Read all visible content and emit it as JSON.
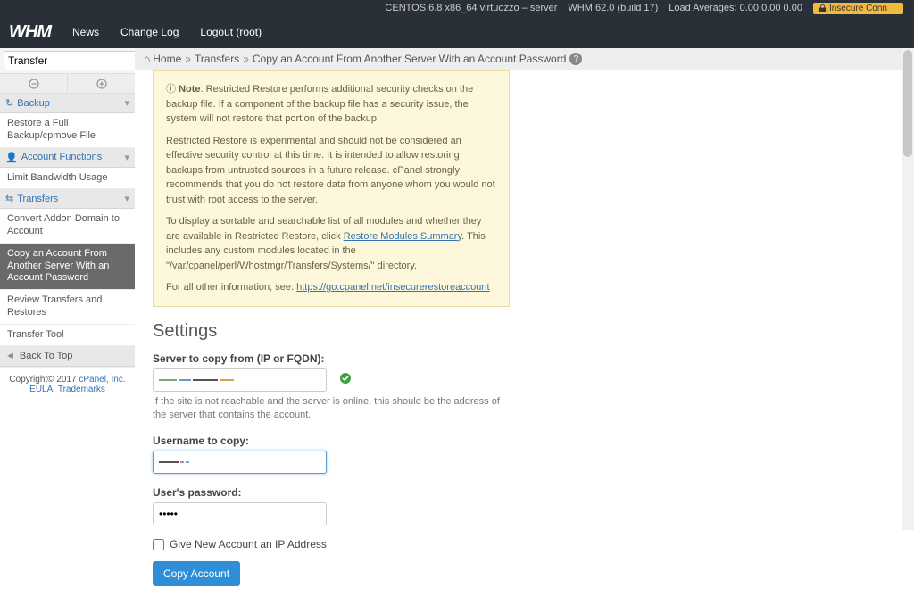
{
  "topbar": {
    "os": "CENTOS 6.8 x86_64 virtuozzo – server",
    "whm": "WHM 62.0 (build 17)",
    "load": "Load Averages: 0.00 0.00 0.00",
    "insecure": "Insecure Conn"
  },
  "nav": {
    "logo": "WHM",
    "news": "News",
    "changelog": "Change Log",
    "logout": "Logout (root)"
  },
  "search": {
    "value": "Transfer"
  },
  "sidebar": {
    "backup_cat": "Backup",
    "backup_item": "Restore a Full Backup/cpmove File",
    "acct_cat": "Account Functions",
    "acct_item": "Limit Bandwidth Usage",
    "trans_cat": "Transfers",
    "t1": "Convert Addon Domain to Account",
    "t2": "Copy an Account From Another Server With an Account Password",
    "t3": "Review Transfers and Restores",
    "t4": "Transfer Tool",
    "backtop": "Back To Top"
  },
  "copyright": {
    "line": "Copyright© 2017 ",
    "cp": "cPanel, Inc.",
    "eula": "EULA",
    "tm": "Trademarks"
  },
  "breadcrumb": {
    "home": "Home",
    "transfers": "Transfers",
    "page": "Copy an Account From Another Server With an Account Password"
  },
  "note": {
    "intro": "Note",
    "p1": ": Restricted Restore performs additional security checks on the backup file. If a component of the backup file has a security issue, the system will not restore that portion of the backup.",
    "p2": "Restricted Restore is experimental and should not be considered an effective security control at this time. It is intended to allow restoring backups from untrusted sources in a future release. cPanel strongly recommends that you do not restore data from anyone whom you would not trust with root access to the server.",
    "p3a": "To display a sortable and searchable list of all modules and whether they are available in Restricted Restore, click ",
    "p3link": "Restore Modules Summary",
    "p3b": ". This includes any custom modules located in the \"/var/cpanel/perl/Whostmgr/Transfers/Systems/\" directory.",
    "p4a": "For all other information, see: ",
    "p4link": "https://go.cpanel.net/insecurerestoreaccount"
  },
  "form": {
    "heading": "Settings",
    "server_label": "Server to copy from (IP or FQDN):",
    "server_hint": "If the site is not reachable and the server is online, this should be the address of the server that contains the account.",
    "user_label": "Username to copy:",
    "pass_label": "User's password:",
    "pass_value": "•••••",
    "chk": "Give New Account an IP Address",
    "submit": "Copy Account"
  }
}
